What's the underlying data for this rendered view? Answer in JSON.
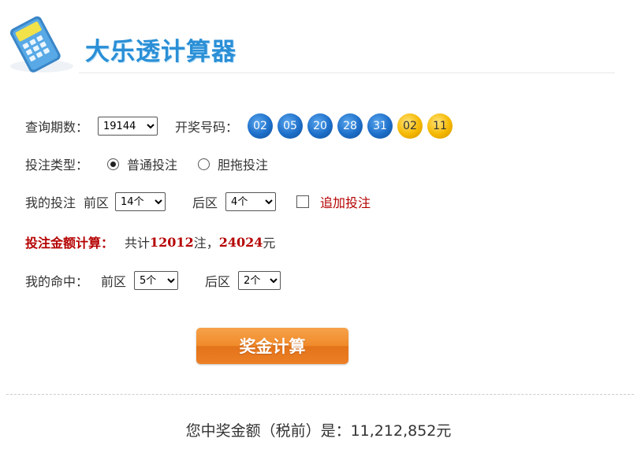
{
  "header": {
    "title": "大乐透计算器"
  },
  "query": {
    "period_label": "查询期数：",
    "period_value": "19144",
    "draw_label": "开奖号码：",
    "front_balls": [
      "02",
      "05",
      "20",
      "28",
      "31"
    ],
    "back_balls": [
      "02",
      "11"
    ]
  },
  "bet_type": {
    "label": "投注类型：",
    "option_normal": "普通投注",
    "option_dantuo": "胆拖投注",
    "selected": "普通投注"
  },
  "my_bet": {
    "label": "我的投注",
    "front_label": "前区",
    "front_value": "14个",
    "back_label": "后区",
    "back_value": "4个",
    "extra_label": "追加投注",
    "extra_checked": false
  },
  "amount": {
    "label": "投注金额计算：",
    "prefix": "共计",
    "count": "12012",
    "count_unit": "注，",
    "money": "24024",
    "money_unit": "元"
  },
  "my_hit": {
    "label": "我的命中：",
    "front_label": "前区",
    "front_value": "5个",
    "back_label": "后区",
    "back_value": "2个"
  },
  "calc_button": {
    "label": "奖金计算"
  },
  "result": {
    "text": "您中奖金额（税前）是：11,212,852元"
  },
  "colors": {
    "accent_blue": "#2a8fd6",
    "highlight_red": "#b50000",
    "button_orange": "#f08a2a",
    "ball_blue": "#1d6fc9",
    "ball_gold": "#f5b800"
  }
}
